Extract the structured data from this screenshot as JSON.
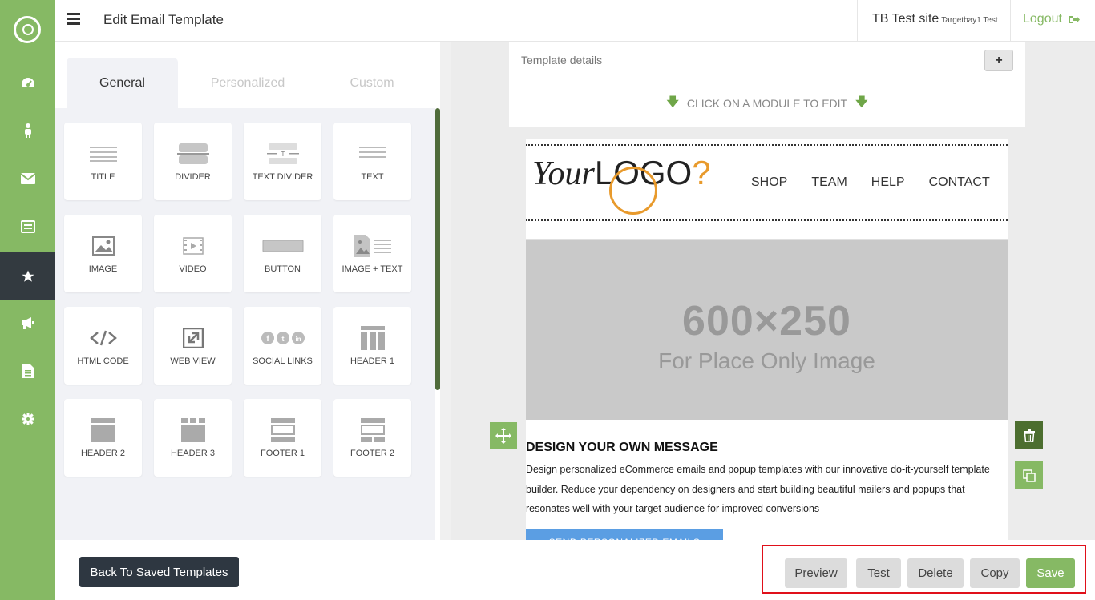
{
  "topbar": {
    "title": "Edit Email Template",
    "site_name": "TB Test site",
    "site_sub": "Targetbay1 Test",
    "logout": "Logout"
  },
  "rail": {
    "items": [
      "dashboard-icon",
      "user-icon",
      "envelope-icon",
      "list-icon",
      "star-icon",
      "megaphone-icon",
      "document-icon",
      "gear-icon"
    ],
    "active": "star-icon",
    "colors": {
      "rail": "#86b964",
      "active": "#333a40"
    }
  },
  "tabs": {
    "general": "General",
    "personalized": "Personalized",
    "custom": "Custom"
  },
  "modules": [
    {
      "label": "TITLE"
    },
    {
      "label": "DIVIDER"
    },
    {
      "label": "TEXT DIVIDER"
    },
    {
      "label": "TEXT"
    },
    {
      "label": "IMAGE"
    },
    {
      "label": "VIDEO"
    },
    {
      "label": "BUTTON"
    },
    {
      "label": "IMAGE + TEXT"
    },
    {
      "label": "HTML CODE"
    },
    {
      "label": "WEB VIEW"
    },
    {
      "label": "SOCIAL LINKS"
    },
    {
      "label": "HEADER 1"
    },
    {
      "label": "HEADER 2"
    },
    {
      "label": "HEADER 3"
    },
    {
      "label": "FOOTER 1"
    },
    {
      "label": "FOOTER 2"
    }
  ],
  "editor": {
    "template_details": "Template details",
    "plus": "+",
    "click_hint": "CLICK ON A MODULE TO EDIT"
  },
  "email": {
    "brand_your": "Your",
    "brand_logo": "LOGO",
    "brand_q": "?",
    "menu": [
      "SHOP",
      "TEAM",
      "HELP",
      "CONTACT"
    ],
    "hero_big": "600×250",
    "hero_small": "For Place Only Image",
    "msg_title": "DESIGN YOUR OWN MESSAGE",
    "msg_body": "Design personalized eCommerce emails and popup templates with our innovative do-it-yourself template builder. Reduce your dependency on designers and start building beautiful mailers and popups that resonates well with your target audience for improved conversions",
    "send_button": "SEND PERSONALIZED EMAILS"
  },
  "bottom": {
    "back": "Back To Saved Templates",
    "preview": "Preview",
    "test": "Test",
    "delete": "Delete",
    "copy": "Copy",
    "save": "Save",
    "highlight_color": "#e0101a"
  }
}
